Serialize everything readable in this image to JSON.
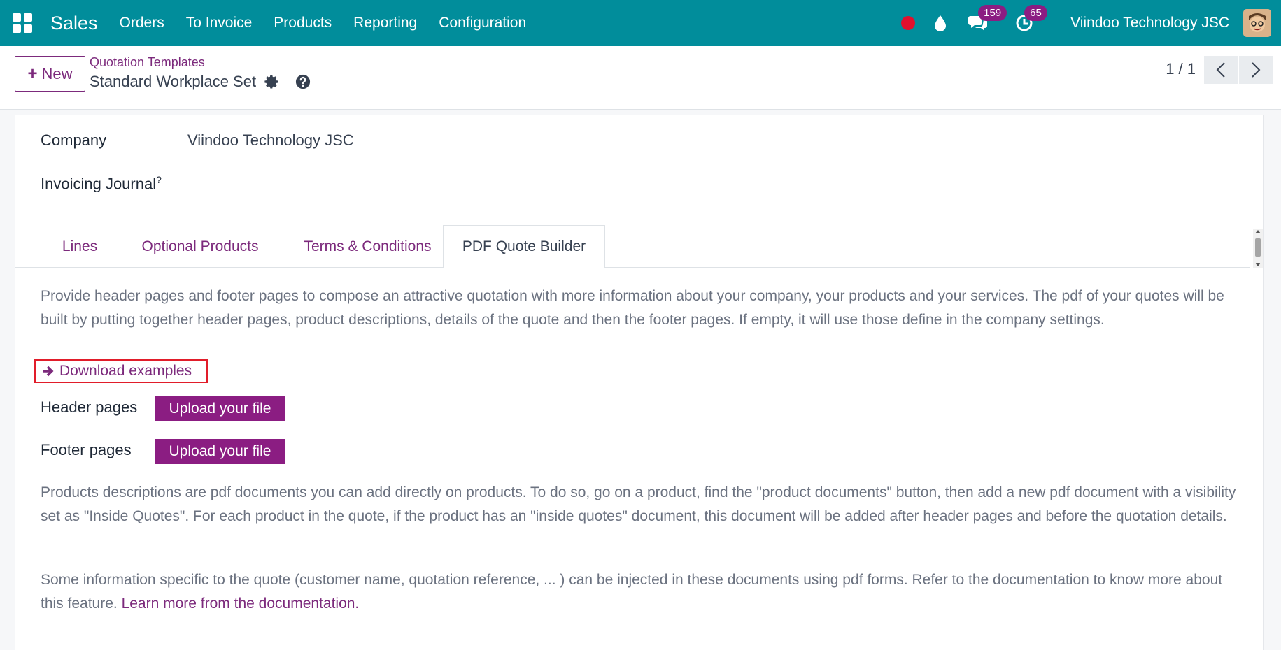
{
  "navbar": {
    "app_name": "Sales",
    "menu": [
      "Orders",
      "To Invoice",
      "Products",
      "Reporting",
      "Configuration"
    ],
    "messages_count": "159",
    "activities_count": "65",
    "company": "Viindoo Technology JSC",
    "bg_color": "#018d9b",
    "badge_color": "#8b1d82"
  },
  "control_panel": {
    "new_label": "New",
    "breadcrumb_parent": "Quotation Templates",
    "record_title": "Standard Workplace Set",
    "pager": "1 / 1"
  },
  "form": {
    "company_label": "Company",
    "company_value": "Viindoo Technology JSC",
    "journal_label": "Invoicing Journal",
    "journal_help": "?"
  },
  "tabs": [
    "Lines",
    "Optional Products",
    "Terms & Conditions",
    "PDF Quote Builder"
  ],
  "pdf_builder": {
    "intro": "Provide header pages and footer pages to compose an attractive quotation with more information about your company, your products and your services. The pdf of your quotes will be built by putting together header pages, product descriptions, details of the quote and then the footer pages. If empty, it will use those define in the company settings.",
    "download_label": "Download examples",
    "header_label": "Header pages",
    "footer_label": "Footer pages",
    "upload_label": "Upload your file",
    "products_desc": "Products descriptions are pdf documents you can add directly on products. To do so, go on a product, find the \"product documents\" button, then add a new pdf document with a visibility set as \"Inside Quotes\". For each product in the quote, if the product has an \"inside quotes\" document, this document will be added after header pages and before the quotation details.",
    "info_text": "Some information specific to the quote (customer name, quotation reference, ... ) can be injected in these documents using pdf forms. Refer to the documentation to know more about this feature.",
    "doc_link": "Learn more from the documentation."
  }
}
